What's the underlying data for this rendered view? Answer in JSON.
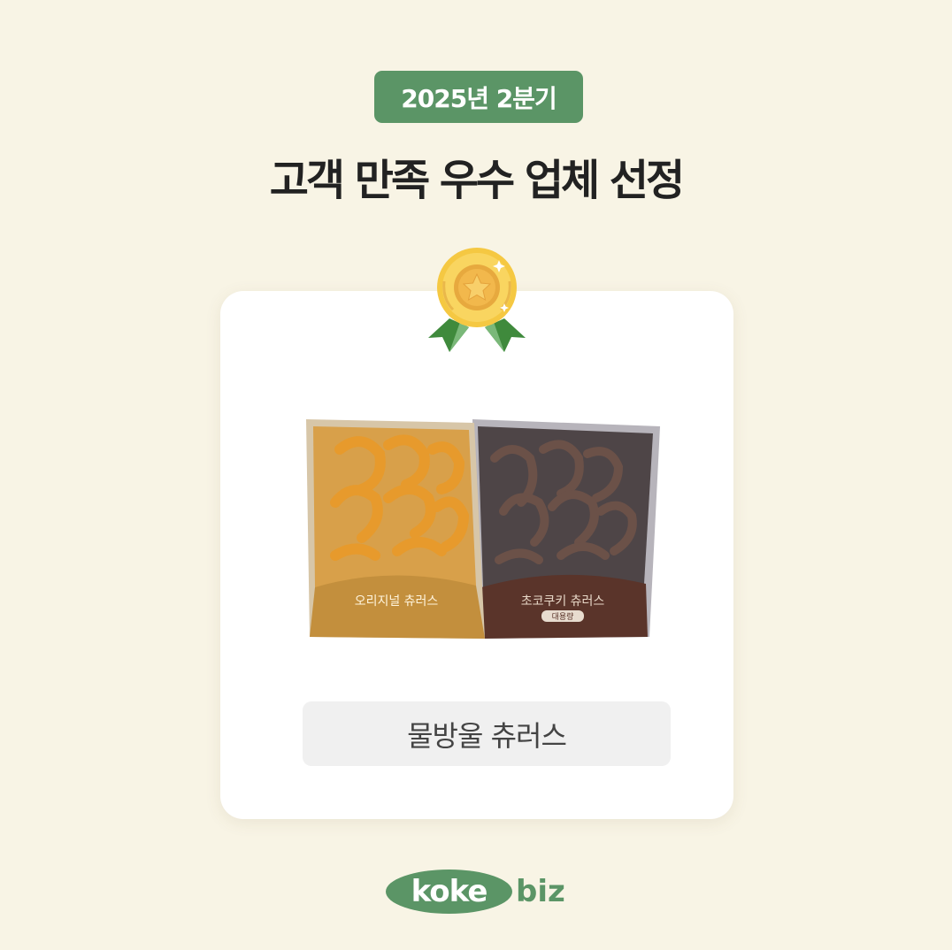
{
  "header": {
    "period_badge": "2025년 2분기",
    "title": "고객 만족 우수 업체 선정"
  },
  "award": {
    "icon": "gold-medal-icon",
    "product_image": "churros-product-packages-image",
    "packages": [
      {
        "label": "오리지널 츄러스",
        "color": "#c99a46"
      },
      {
        "label": "초코쿠키 츄러스",
        "sublabel": "대용량",
        "color": "#4a3a36"
      }
    ],
    "product_name": "물방울 츄러스"
  },
  "brand": {
    "logo_main": "koke",
    "logo_suffix": "biz",
    "color": "#5b9566"
  },
  "colors": {
    "background": "#f8f4e5",
    "accent": "#5b9566",
    "card": "#ffffff"
  }
}
